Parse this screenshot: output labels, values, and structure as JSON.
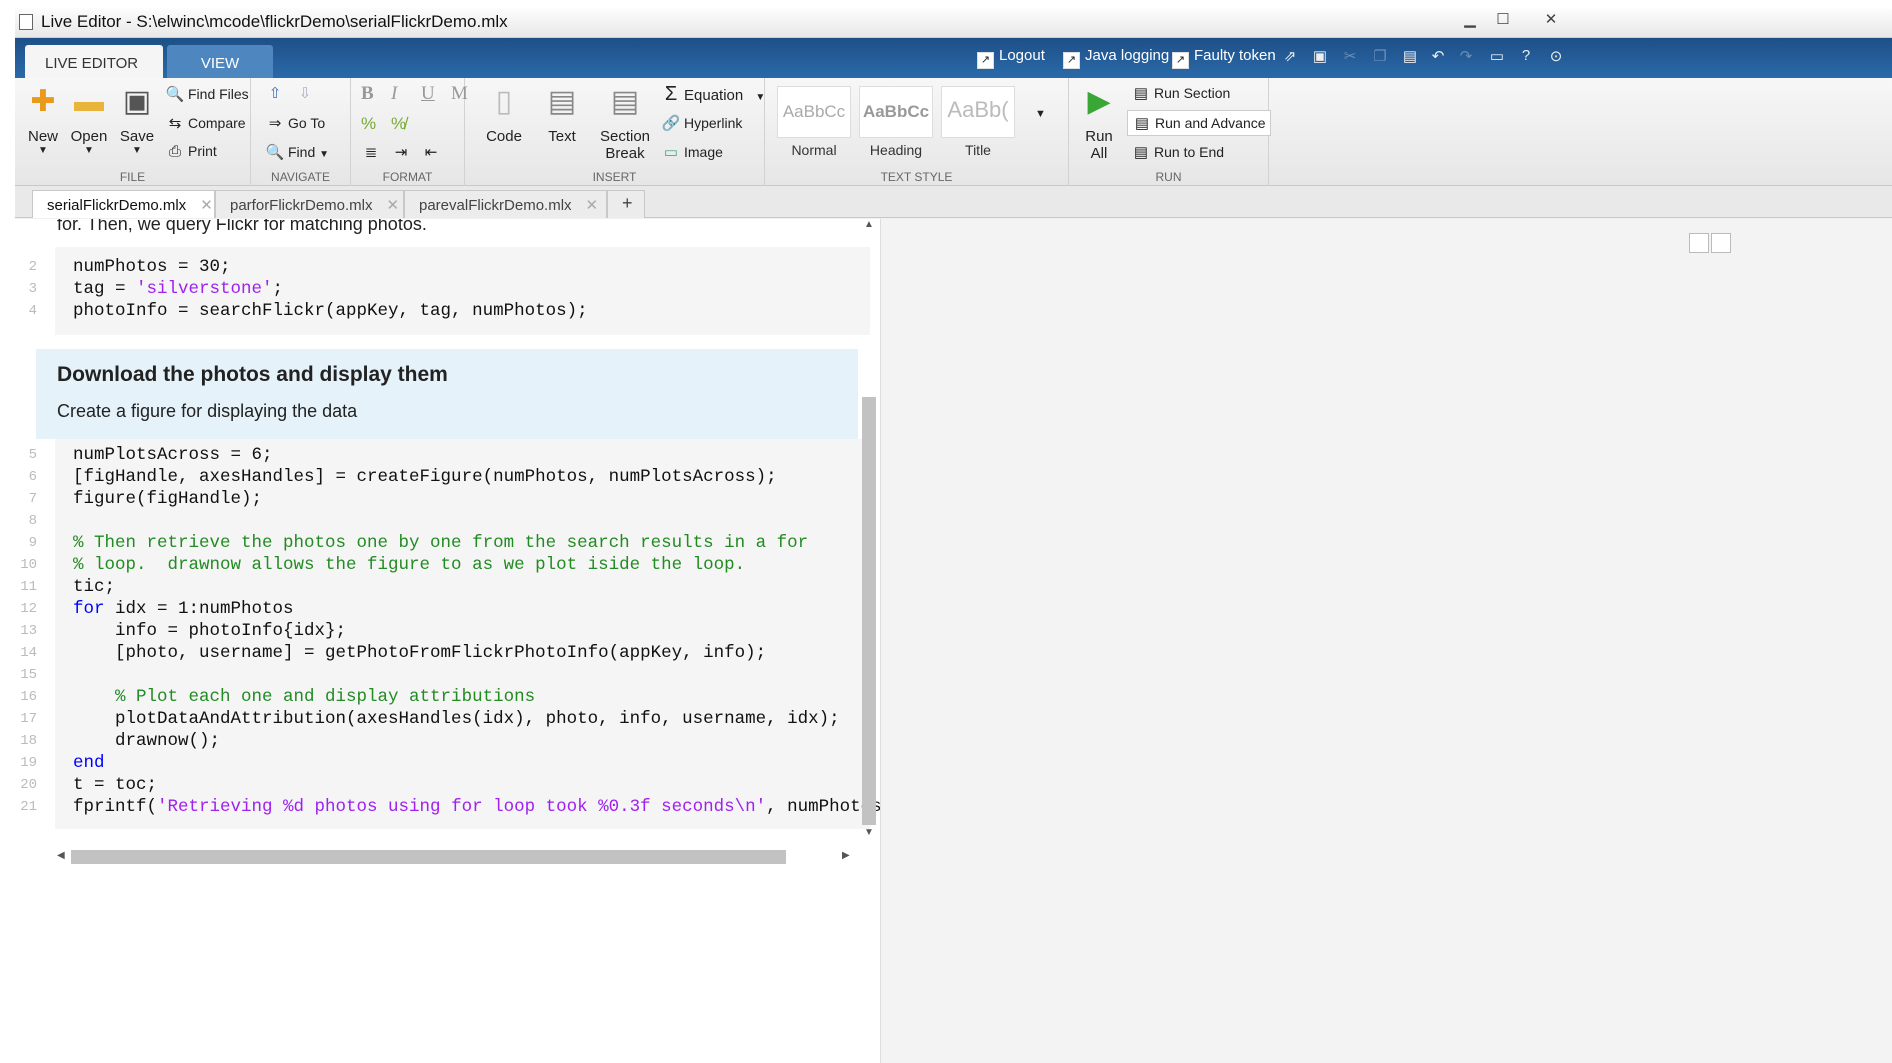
{
  "window": {
    "title": "Live Editor - S:\\elwinc\\mcode\\flickrDemo\\serialFlickrDemo.mlx"
  },
  "ribbon_tabs": {
    "live_editor": "LIVE EDITOR",
    "view": "VIEW"
  },
  "quick_access": {
    "logout": "Logout",
    "java_logging": "Java logging",
    "faulty_token": "Faulty token"
  },
  "file_group": {
    "label": "FILE",
    "new": "New",
    "open": "Open",
    "save": "Save",
    "find_files": "Find Files",
    "compare": "Compare",
    "print": "Print"
  },
  "navigate_group": {
    "label": "NAVIGATE",
    "go_to": "Go To",
    "find": "Find"
  },
  "format_group": {
    "label": "FORMAT",
    "bold": "B",
    "italic": "I",
    "underline": "U",
    "mono": "M"
  },
  "insert_group": {
    "label": "INSERT",
    "code": "Code",
    "text": "Text",
    "section": "Section",
    "break": "Break",
    "equation": "Equation",
    "hyperlink": "Hyperlink",
    "image": "Image"
  },
  "text_style_group": {
    "label": "TEXT STYLE",
    "styles": [
      {
        "preview": "AaBbCc",
        "name": "Normal"
      },
      {
        "preview": "AaBbCc",
        "name": "Heading"
      },
      {
        "preview": "AaBb(",
        "name": "Title"
      }
    ]
  },
  "run_group": {
    "label": "RUN",
    "run": "Run",
    "all": "All",
    "run_section": "Run Section",
    "run_and_advance": "Run and Advance",
    "run_to_end": "Run to End"
  },
  "doc_tabs": [
    {
      "label": "serialFlickrDemo.mlx"
    },
    {
      "label": "parforFlickrDemo.mlx"
    },
    {
      "label": "parevalFlickrDemo.mlx"
    }
  ],
  "editor": {
    "top_text": "for. Then, we query Flickr for matching photos.",
    "heading": "Download the photos and display them",
    "body_text": "Create a figure for displaying the data",
    "line_numbers": [
      "2",
      "3",
      "4",
      "5",
      "6",
      "7",
      "8",
      "9",
      "10",
      "11",
      "12",
      "13",
      "14",
      "15",
      "16",
      "17",
      "18",
      "19",
      "20",
      "21"
    ]
  }
}
